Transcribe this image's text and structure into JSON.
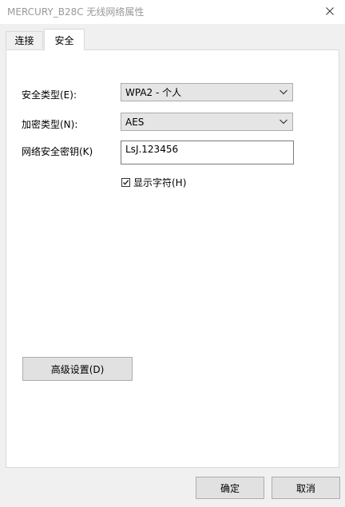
{
  "window": {
    "title": "MERCURY_B28C 无线网络属性",
    "close_icon": "close-icon"
  },
  "tabs": [
    {
      "label": "连接",
      "active": false
    },
    {
      "label": "安全",
      "active": true
    }
  ],
  "security": {
    "security_type_label": "安全类型(E):",
    "security_type_value": "WPA2 - 个人",
    "encryption_type_label": "加密类型(N):",
    "encryption_type_value": "AES",
    "key_label": "网络安全密钥(K)",
    "key_value": "LsJ.123456",
    "show_chars_label": "显示字符(H)",
    "show_chars_checked": true,
    "advanced_button": "高级设置(D)"
  },
  "buttons": {
    "ok": "确定",
    "cancel": "取消"
  }
}
